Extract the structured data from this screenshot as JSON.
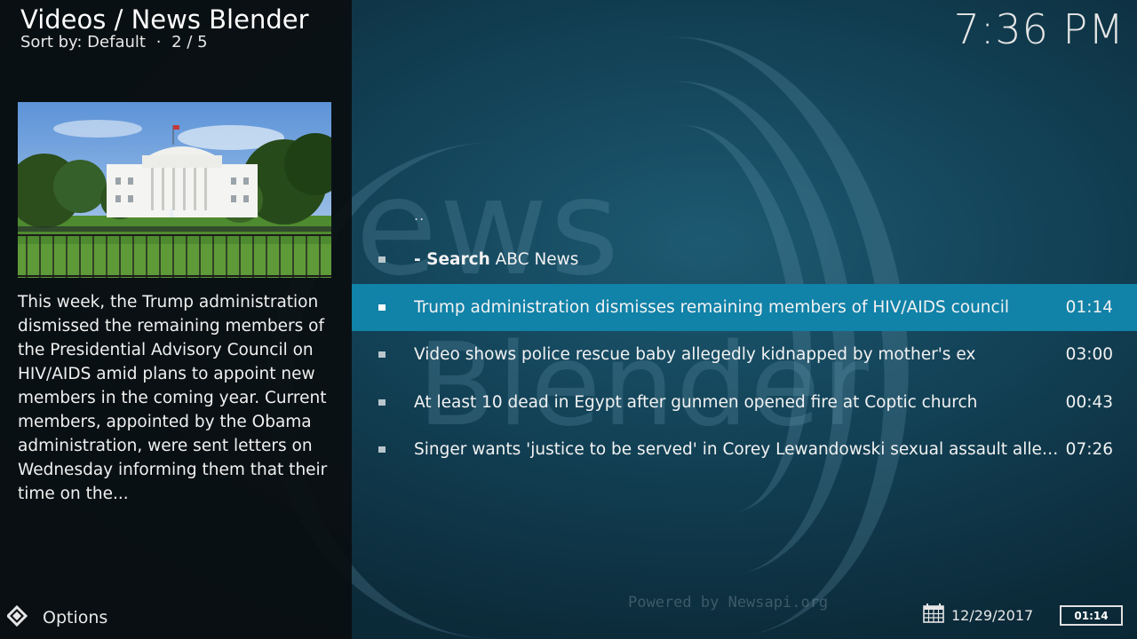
{
  "header": {
    "title": "Videos / News Blender",
    "sort_label": "Sort by: Default",
    "separator": "·",
    "position": "2 / 5"
  },
  "clock": "7:36 PM",
  "plot": "This week, the Trump administration dismissed the remaining members of the Presidential Advisory Council on HIV/AIDS amid plans to appoint new members in the coming year. Current members, appointed by the Obama administration, were sent letters on Wednesday informing them that their time on the...",
  "options_label": "Options",
  "list": {
    "parent": "..",
    "search": {
      "prefix": "- Search",
      "label": "ABC News"
    },
    "items": [
      {
        "title": "Trump administration dismisses remaining members of HIV/AIDS council",
        "duration": "01:14"
      },
      {
        "title": "Video shows police rescue baby allegedly kidnapped by mother's ex",
        "duration": "03:00"
      },
      {
        "title": "At least 10 dead in Egypt after gunmen opened fire at Coptic church",
        "duration": "00:43"
      },
      {
        "title": "Singer wants 'justice to be served' in Corey Lewandowski sexual assault alleg...",
        "duration": "07:26"
      }
    ]
  },
  "footer": {
    "powered_by": "Powered by Newsapi.org",
    "date": "12/29/2017",
    "duration": "01:14"
  },
  "background_watermark": {
    "word1": "ews",
    "word2": "Blender"
  },
  "colors": {
    "selected_row": "#1182a8",
    "panel": "#0a0e10"
  },
  "icons": {
    "options": "options-diamond-icon",
    "calendar": "calendar-icon"
  }
}
